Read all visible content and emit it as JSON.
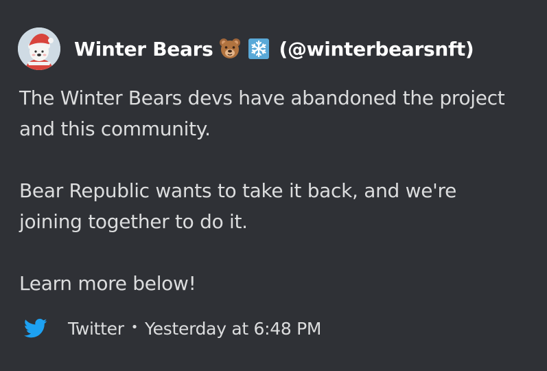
{
  "author": {
    "name": "Winter Bears",
    "emoji_1": "bear-face-emoji",
    "emoji_2": "snowflake-emoji",
    "handle": "(@winterbearsnft)",
    "avatar_icon": "polar-bear-santa-hat-avatar"
  },
  "description": {
    "paragraph_1_line_1": "The Winter Bears devs have abandoned the project",
    "paragraph_1_line_2": "and this community.",
    "paragraph_2_line_1": "Bear Republic wants to take it back, and we're",
    "paragraph_2_line_2": "joining together to do it.",
    "paragraph_3": "Learn more below!"
  },
  "footer": {
    "icon": "twitter-bird-icon",
    "source": "Twitter",
    "separator": "•",
    "timestamp": "Yesterday at 6:48 PM"
  },
  "colors": {
    "background": "#2f3136",
    "title": "#ffffff",
    "text": "#dcddde",
    "twitter_blue": "#1da1f2"
  }
}
